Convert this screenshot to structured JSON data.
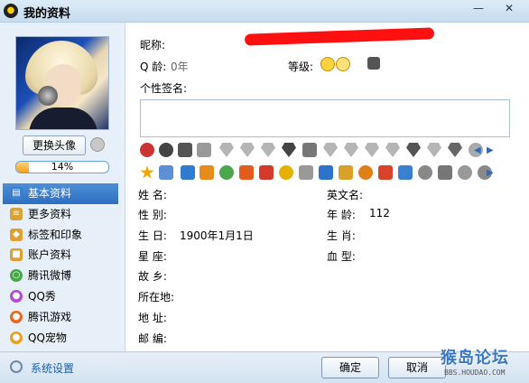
{
  "window": {
    "title": "我的资料",
    "minimize_label": "—",
    "close_label": "✕"
  },
  "profile": {
    "change_avatar_label": "更换头像",
    "level_progress_percent": 14,
    "level_progress_text": "14%"
  },
  "sidebar": {
    "items": [
      {
        "label": "基本资料",
        "icon": "card-icon",
        "color": "#3b7fd1"
      },
      {
        "label": "更多资料",
        "icon": "notebook-icon",
        "color": "#d6a23a"
      },
      {
        "label": "标签和印象",
        "icon": "tag-icon",
        "color": "#e0a030"
      },
      {
        "label": "账户资料",
        "icon": "account-icon",
        "color": "#e0a030"
      },
      {
        "label": "腾讯微博",
        "icon": "weibo-icon",
        "color": "#47a64a"
      },
      {
        "label": "QQ秀",
        "icon": "qqshow-icon",
        "color": "#b44ad6"
      },
      {
        "label": "腾讯游戏",
        "icon": "game-icon",
        "color": "#e86a1f"
      },
      {
        "label": "QQ宠物",
        "icon": "pet-icon",
        "color": "#e8a21f"
      }
    ]
  },
  "info": {
    "nickname_label": "昵称:",
    "qage_label": "Q 龄:",
    "qage_value": "0年",
    "level_label": "等级:",
    "signature_label": "个性签名:",
    "fields_left": [
      {
        "label": "姓    名:",
        "value": ""
      },
      {
        "label": "性    别:",
        "value": ""
      },
      {
        "label": "生    日:",
        "value": "1900年1月1日"
      },
      {
        "label": "星    座:",
        "value": ""
      },
      {
        "label": "故    乡:",
        "value": ""
      },
      {
        "label": "所在地:",
        "value": ""
      },
      {
        "label": "地    址:",
        "value": ""
      },
      {
        "label": "邮    编:",
        "value": ""
      }
    ],
    "fields_right": [
      {
        "label": "英文名:",
        "value": ""
      },
      {
        "label": "年    龄:",
        "value": "112"
      },
      {
        "label": "生    肖:",
        "value": ""
      },
      {
        "label": "血    型:",
        "value": ""
      }
    ]
  },
  "footer": {
    "settings_label": "系统设置",
    "ok_label": "确定",
    "cancel_label": "取消"
  },
  "watermark": {
    "title": "猴岛论坛",
    "url": "BBS.HOUDAO.COM"
  },
  "colors": {
    "accent": "#2c6fc2",
    "redaction": "#ff1010"
  }
}
